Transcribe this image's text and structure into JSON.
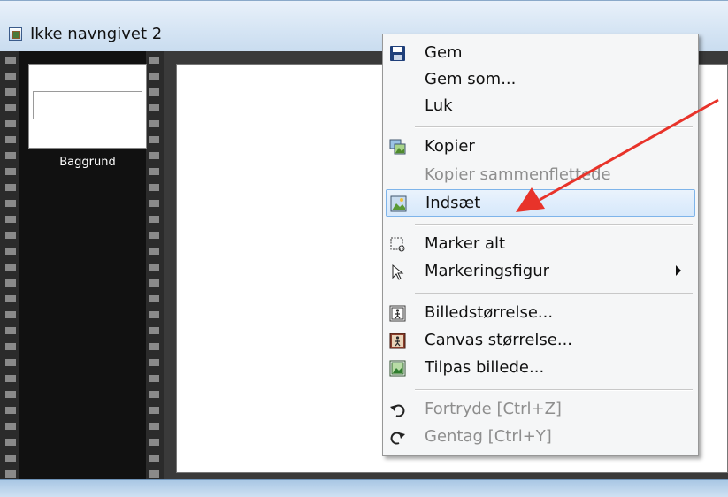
{
  "window": {
    "title": "Ikke navngivet 2"
  },
  "layers": [
    {
      "label": "Baggrund"
    }
  ],
  "context_menu": {
    "items": [
      {
        "label": "Gem",
        "icon": "floppy-disk-icon",
        "enabled": true
      },
      {
        "label": "Gem som...",
        "icon": "",
        "enabled": true
      },
      {
        "label": "Luk",
        "icon": "",
        "enabled": true
      },
      {
        "label": "Kopier",
        "icon": "copy-image-icon",
        "enabled": true
      },
      {
        "label": "Kopier sammenflettede",
        "icon": "",
        "enabled": false
      },
      {
        "label": "Indsæt",
        "icon": "paste-image-icon",
        "enabled": true,
        "highlighted": true
      },
      {
        "label": "Marker alt",
        "icon": "select-all-icon",
        "enabled": true
      },
      {
        "label": "Markeringsfigur",
        "icon": "pointer-icon",
        "enabled": true,
        "submenu": true
      },
      {
        "label": "Billedstørrelse...",
        "icon": "image-size-icon",
        "enabled": true
      },
      {
        "label": "Canvas størrelse...",
        "icon": "canvas-size-icon",
        "enabled": true
      },
      {
        "label": "Tilpas billede...",
        "icon": "fit-image-icon",
        "enabled": true
      },
      {
        "label": "Fortryde [Ctrl+Z]",
        "icon": "undo-icon",
        "enabled": false
      },
      {
        "label": "Gentag [Ctrl+Y]",
        "icon": "redo-icon",
        "enabled": false
      }
    ]
  },
  "annotation": {
    "arrow_color": "#e8332a"
  },
  "colors": {
    "highlight_border": "#7eb4ea",
    "disabled_text": "#8e8e8e"
  }
}
